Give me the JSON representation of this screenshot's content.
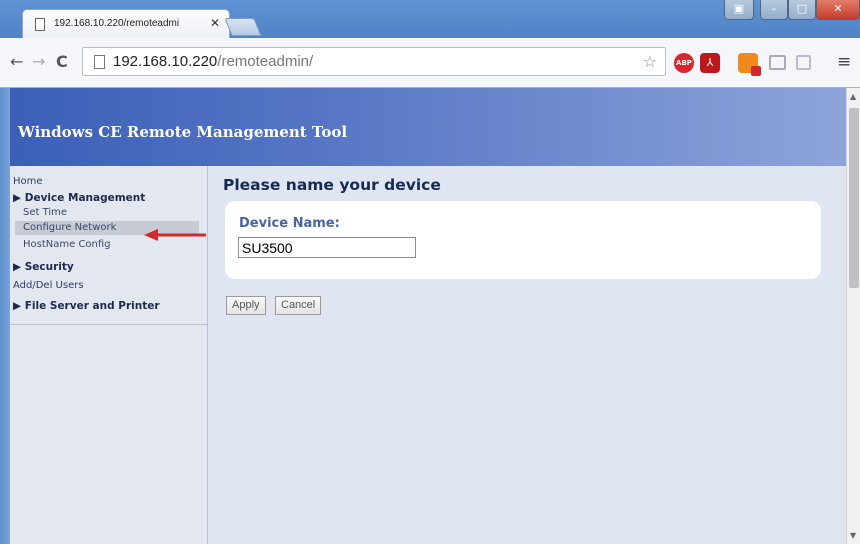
{
  "browser": {
    "tab_title": "192.168.10.220/remoteadmi",
    "url_host": "192.168.10.220",
    "url_path": "/remoteadmin/",
    "icons": [
      "back-icon",
      "forward-icon",
      "reload-icon",
      "star-icon",
      "adblock-icon",
      "pdf-icon",
      "rss-icon",
      "cast-icon",
      "edit-icon",
      "menu-icon"
    ]
  },
  "banner": {
    "title": "Windows CE Remote Management Tool"
  },
  "sidebar": {
    "home": "Home",
    "device_management": "▶ Device Management",
    "set_time": "Set Time",
    "configure_network": "Configure Network",
    "hostname_config": "HostName Config",
    "security": "▶ Security",
    "add_del_users": "Add/Del Users",
    "file_server": "▶ File Server and Printer"
  },
  "content": {
    "title": "Please name your device",
    "field_label": "Device Name:",
    "device_name_value": "SU3500",
    "apply": "Apply",
    "cancel": "Cancel"
  },
  "colors": {
    "banner": "#3b5fb7",
    "marker": "#d22a2a",
    "label": "#4a63a8"
  }
}
